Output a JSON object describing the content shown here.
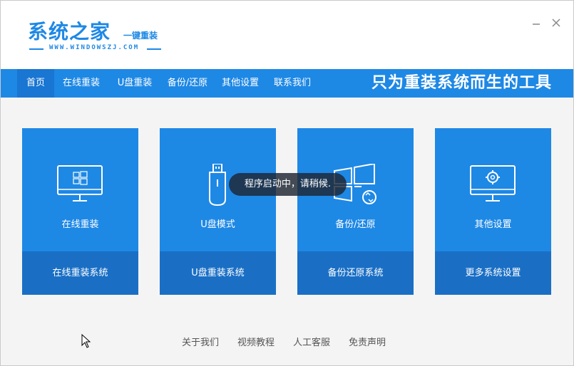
{
  "header": {
    "logo_title": "系统之家",
    "logo_subtitle": "一键重装",
    "logo_url": "WWW.WINDOWSZJ.COM",
    "minimize_label": "—",
    "close_label": "✕"
  },
  "nav": {
    "items": [
      {
        "label": "首页",
        "active": true
      },
      {
        "label": "在线重装"
      },
      {
        "label": "U盘重装"
      },
      {
        "label": "备份/还原"
      },
      {
        "label": "其他设置"
      },
      {
        "label": "联系我们"
      }
    ],
    "slogan": "只为重装系统而生的工具"
  },
  "cards": [
    {
      "title": "在线重装",
      "action": "在线重装系统",
      "icon": "monitor-windows-icon"
    },
    {
      "title": "U盘模式",
      "action": "U盘重装系统",
      "icon": "usb-drive-icon"
    },
    {
      "title": "备份/还原",
      "action": "备份还原系统",
      "icon": "windows-restore-icon"
    },
    {
      "title": "其他设置",
      "action": "更多系统设置",
      "icon": "monitor-gear-icon"
    }
  ],
  "toast": "程序启动中，请稍候.",
  "footer": {
    "links": [
      "关于我们",
      "视频教程",
      "人工客服",
      "免责声明"
    ]
  },
  "colors": {
    "primary": "#1e88e5",
    "card_bottom": "#1a6fc5",
    "nav_active": "#1976d2"
  }
}
